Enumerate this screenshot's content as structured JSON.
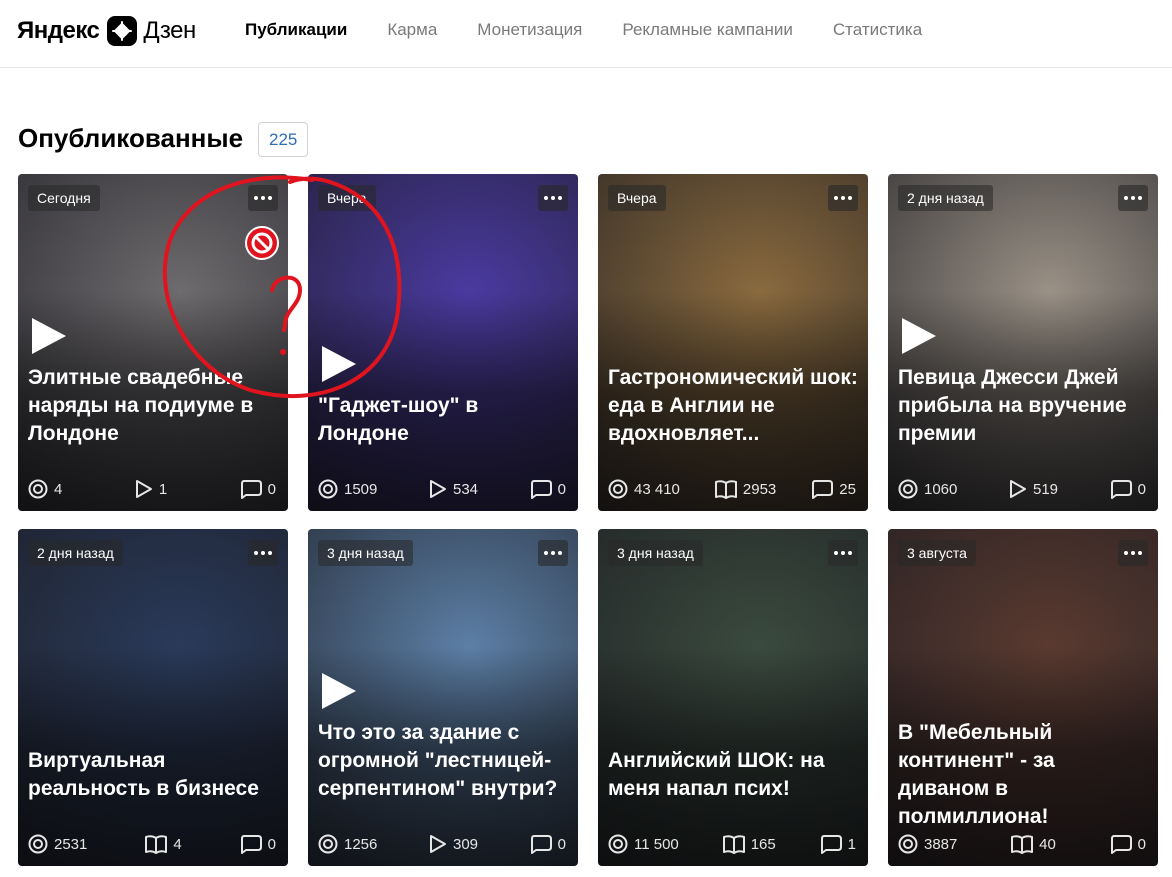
{
  "brand": {
    "yandex": "Яндекс",
    "dzen": "Дзен"
  },
  "nav": [
    {
      "label": "Публикации",
      "active": true
    },
    {
      "label": "Карма",
      "active": false
    },
    {
      "label": "Монетизация",
      "active": false
    },
    {
      "label": "Рекламные кампании",
      "active": false
    },
    {
      "label": "Статистика",
      "active": false
    }
  ],
  "section": {
    "title": "Опубликованные",
    "count": "225"
  },
  "cards": [
    {
      "date": "Сегодня",
      "title": "Элитные свадебные наряды на подиуме в Лондоне",
      "views": "4",
      "second": "1",
      "second_icon": "play-icon",
      "comments": "0",
      "has_play": true,
      "blocked": true,
      "bg_color": "#6e6b6e"
    },
    {
      "date": "Вчера",
      "title": "\"Гаджет-шоу\" в Лондоне",
      "views": "1509",
      "second": "534",
      "second_icon": "play-icon",
      "comments": "0",
      "has_play": true,
      "blocked": false,
      "bg_color": "#4a3aa0"
    },
    {
      "date": "Вчера",
      "title": "Гастрономический шок: еда в Англии не вдохновляет...",
      "views": "43 410",
      "second": "2953",
      "second_icon": "book-icon",
      "comments": "25",
      "has_play": false,
      "blocked": false,
      "bg_color": "#8a6a3e"
    },
    {
      "date": "2 дня назад",
      "title": "Певица Джесси Джей прибыла на вручение премии",
      "views": "1060",
      "second": "519",
      "second_icon": "play-icon",
      "comments": "0",
      "has_play": true,
      "blocked": false,
      "bg_color": "#9a9186"
    },
    {
      "date": "2 дня назад",
      "title": "Виртуальная реальность в бизнесе",
      "views": "2531",
      "second": "4",
      "second_icon": "book-icon",
      "comments": "0",
      "has_play": false,
      "blocked": false,
      "bg_color": "#2a3a5a"
    },
    {
      "date": "3 дня назад",
      "title": "Что это за здание с огромной \"лестницей-серпентином\" внутри?",
      "views": "1256",
      "second": "309",
      "second_icon": "play-icon",
      "comments": "0",
      "has_play": true,
      "blocked": false,
      "bg_color": "#5c7fa6"
    },
    {
      "date": "3 дня назад",
      "title": "Английский ШОК: на меня напал псих!",
      "views": "11 500",
      "second": "165",
      "second_icon": "book-icon",
      "comments": "1",
      "has_play": false,
      "blocked": false,
      "bg_color": "#3a4a3e"
    },
    {
      "date": "3 августа",
      "title": "В \"Мебельный континент\" - за диваном в полмиллиона!",
      "views": "3887",
      "second": "40",
      "second_icon": "book-icon",
      "comments": "0",
      "has_play": false,
      "blocked": false,
      "bg_color": "#5a3a30"
    }
  ],
  "annotation": {
    "symbol": "?",
    "color": "#e0141e"
  }
}
